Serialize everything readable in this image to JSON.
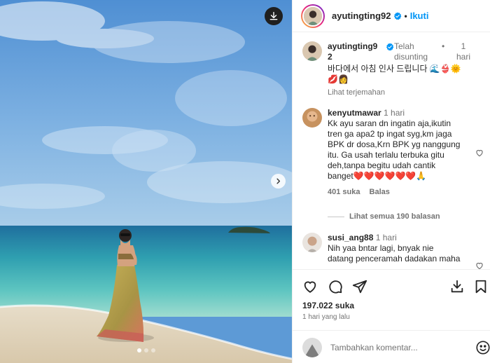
{
  "post": {
    "author": "ayutingting92",
    "follow_label": "Ikuti",
    "separator": "•"
  },
  "caption": {
    "username_line1": "ayutingting9",
    "username_line2": "2",
    "edited_label_1": "Telah",
    "edited_label_2": "disunting",
    "separator": "•",
    "time_1": "1",
    "time_2": "hari",
    "text_line1": "바다에서 아침 인사 드립니다 🌊👙🌞",
    "text_line2": "💋👩",
    "translate_label": "Lihat terjemahan"
  },
  "comments": [
    {
      "username": "kenyutmawar",
      "time": "1 hari",
      "lines": [
        "Kk ayu saran dn ingatin aja,ikutin",
        "tren ga apa2 tp ingat syg,km jaga",
        "BPK dr dosa,Krn BPK yg nanggung",
        "itu. Ga usah terlalu terbuka gitu",
        "deh,tanpa begitu udah cantik",
        "banget❤️❤️❤️❤️❤️❤️🙏"
      ],
      "likes": "401 suka",
      "reply_label": "Balas",
      "view_replies": "Lihat semua 190 balasan"
    },
    {
      "username": "susi_ang88",
      "time": "1 hari",
      "lines": [
        "Nih yaa bntar lagi, bnyak nie",
        "datang penceramah dadakan maha"
      ]
    }
  ],
  "stats": {
    "likes": "197.022 suka",
    "posted": "1 hari yang lalu"
  },
  "add_comment": {
    "placeholder": "Tambahkan komentar..."
  },
  "carousel": {
    "slides": 3,
    "active": 1
  },
  "colors": {
    "accent": "#0095f6",
    "verified": "#0095f6",
    "text": "#262626",
    "muted": "#737373"
  }
}
